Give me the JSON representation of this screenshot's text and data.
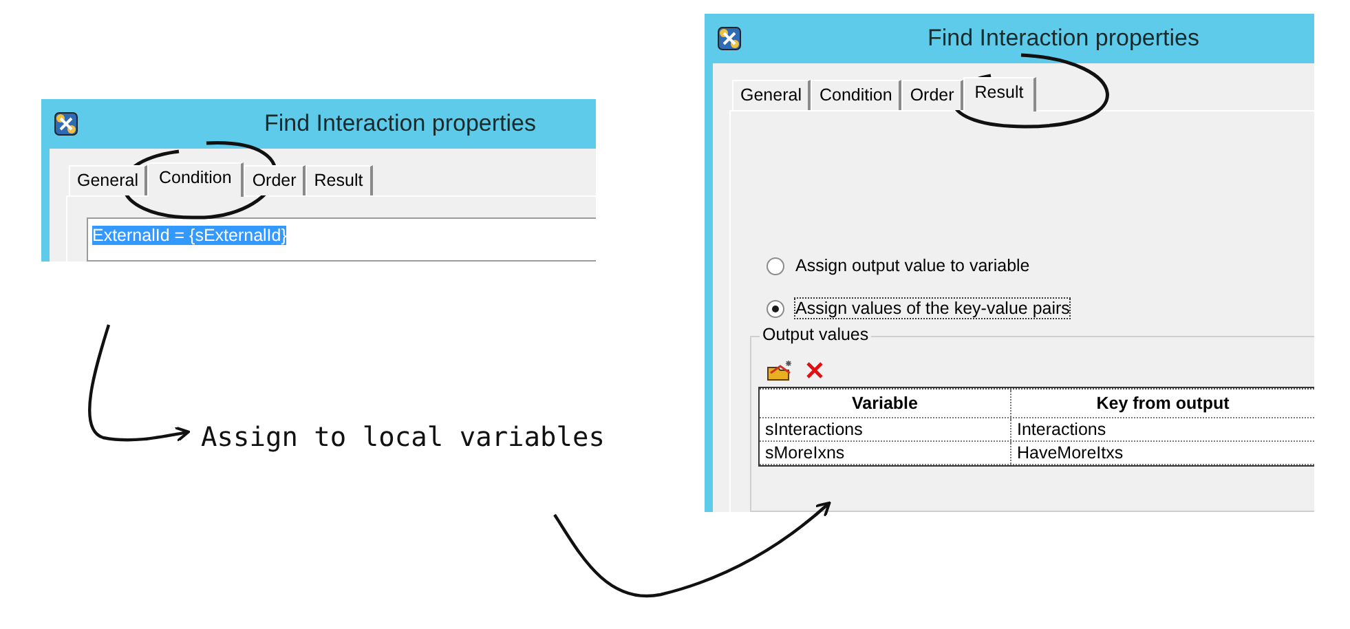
{
  "left_dialog": {
    "title": "Find Interaction properties",
    "tabs": [
      {
        "label": "General",
        "selected": false
      },
      {
        "label": "Condition",
        "selected": true
      },
      {
        "label": "Order",
        "selected": false
      },
      {
        "label": "Result",
        "selected": false
      }
    ],
    "condition_text": "ExternalId = {sExternalId}"
  },
  "annotation": {
    "label": "Assign to local variables"
  },
  "right_dialog": {
    "title": "Find Interaction properties",
    "tabs": [
      {
        "label": "General",
        "selected": false
      },
      {
        "label": "Condition",
        "selected": false
      },
      {
        "label": "Order",
        "selected": false
      },
      {
        "label": "Result",
        "selected": true
      }
    ],
    "options": [
      {
        "label": "Assign output value to variable",
        "selected": false
      },
      {
        "label": "Assign values of the key-value pairs",
        "selected": true
      }
    ],
    "output_group": {
      "title": "Output values",
      "columns": [
        "Variable",
        "Key from output"
      ],
      "rows": [
        [
          "sInteractions",
          "Interactions"
        ],
        [
          "sMoreIxns",
          "HaveMoreItxs"
        ]
      ]
    }
  }
}
